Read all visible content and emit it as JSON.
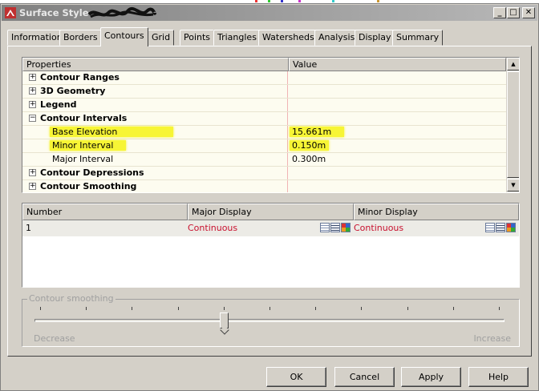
{
  "window": {
    "title": "Surface Style",
    "controls": {
      "minimize": "_",
      "maximize": "□",
      "close": "✕"
    }
  },
  "tabs": [
    {
      "label": "Information"
    },
    {
      "label": "Borders"
    },
    {
      "label": "Contours",
      "active": true
    },
    {
      "label": "Grid"
    },
    {
      "label": "Points"
    },
    {
      "label": "Triangles"
    },
    {
      "label": "Watersheds"
    },
    {
      "label": "Analysis"
    },
    {
      "label": "Display"
    },
    {
      "label": "Summary"
    }
  ],
  "properties": {
    "columns": [
      "Properties",
      "Value"
    ],
    "rows": [
      {
        "name": "Contour Ranges",
        "type": "category",
        "expander": "+"
      },
      {
        "name": "3D Geometry",
        "type": "category",
        "expander": "+"
      },
      {
        "name": "Legend",
        "type": "category",
        "expander": "+"
      },
      {
        "name": "Contour Intervals",
        "type": "category",
        "expander": "−"
      },
      {
        "name": "Base Elevation",
        "value": "15.661m",
        "type": "child",
        "highlighted": true
      },
      {
        "name": "Minor Interval",
        "value": "0.150m",
        "type": "child",
        "highlighted": true
      },
      {
        "name": "Major Interval",
        "value": "0.300m",
        "type": "child"
      },
      {
        "name": "Contour Depressions",
        "type": "category",
        "expander": "+"
      },
      {
        "name": "Contour Smoothing",
        "type": "category",
        "expander": "+"
      }
    ],
    "scroll_up": "▲",
    "scroll_down": "▼"
  },
  "display_table": {
    "columns": [
      "Number",
      "Major Display",
      "Minor Display"
    ],
    "rows": [
      {
        "number": "1",
        "major": "Continuous",
        "minor": "Continuous"
      }
    ]
  },
  "smoothing": {
    "legend": "Contour smoothing",
    "min_label": "Decrease",
    "max_label": "Increase",
    "tick_count": 11,
    "value_fraction": 0.4
  },
  "buttons": {
    "ok": "OK",
    "cancel": "Cancel",
    "apply": "Apply",
    "help": "Help"
  },
  "colors": {
    "highlight": "#f7f535",
    "linetype_text": "#c8102e",
    "grid_row_bg": "#fdfcf0"
  }
}
